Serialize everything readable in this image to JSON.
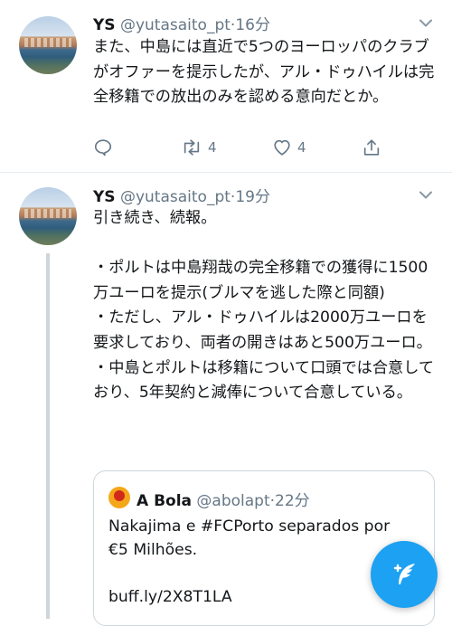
{
  "tweets": [
    {
      "name": "YS",
      "handle": "@yutasaito_pt",
      "separator": "·",
      "time": "16分",
      "text": "また、中島には直近で5つのヨーロッパのクラブがオファーを提示したが、アル・ドゥハイルは完全移籍での放出のみを認める意向だとか。",
      "retweets": "4",
      "likes": "4"
    },
    {
      "name": "YS",
      "handle": "@yutasaito_pt",
      "separator": "·",
      "time": "19分",
      "text": "引き続き、続報。\n\n・ポルトは中島翔哉の完全移籍での獲得に1500万ユーロを提示(ブルマを逃した際と同額)\n・ただし、アル・ドゥハイルは2000万ユーロを要求しており、両者の開きはあと500万ユーロ。\n・中島とポルトは移籍について口頭では合意しており、5年契約と減俸について合意している。",
      "quote": {
        "name": "A Bola",
        "handle": "@abolapt",
        "separator": "·",
        "time": "22分",
        "text": "Nakajima e #FCPorto separados por\n€5 Milhões.\n\nbuff.ly/2X8T1LA"
      }
    }
  ],
  "icons": {
    "reply": "reply-icon",
    "retweet": "retweet-icon",
    "like": "heart-icon",
    "share": "share-icon",
    "menu": "chevron-down-icon",
    "compose": "compose-tweet-icon"
  },
  "colors": {
    "accent": "#1da1f2",
    "secondary": "#657786",
    "border": "#e6ecf0"
  }
}
